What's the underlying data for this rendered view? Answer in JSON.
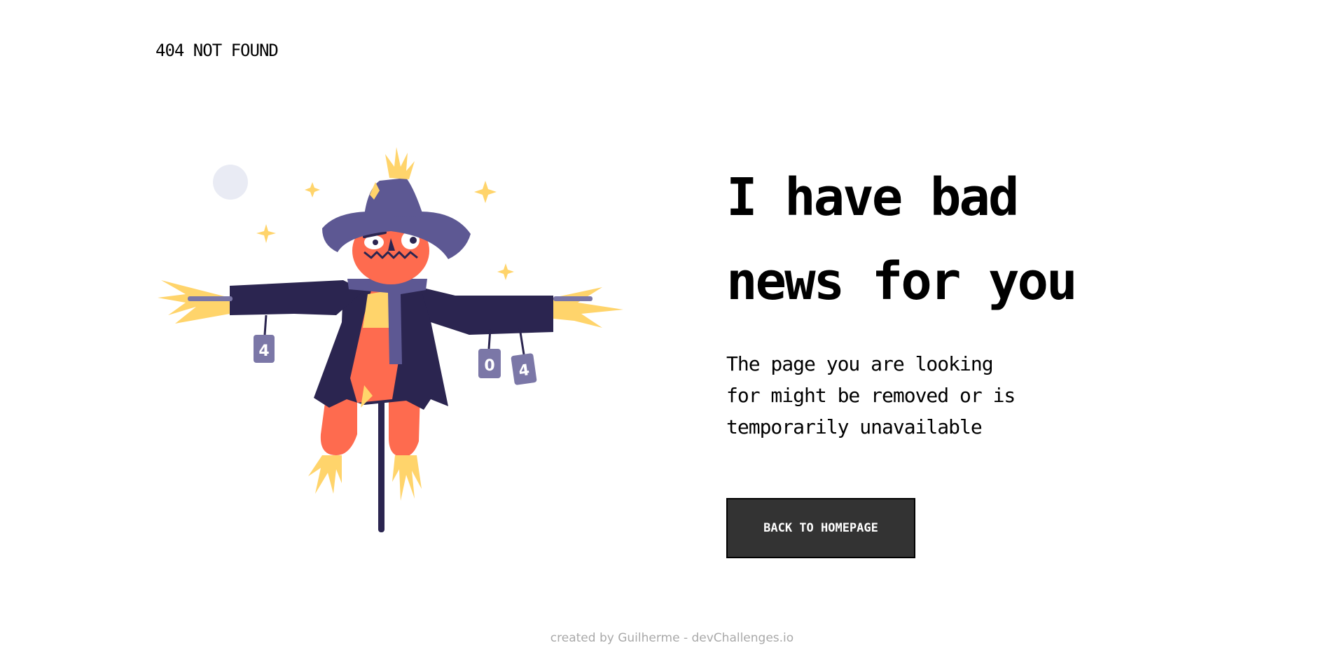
{
  "header": {
    "logo_text": "404 NOT FOUND"
  },
  "illustration": {
    "subject": "scarecrow-illustration",
    "can_labels": [
      "4",
      "0",
      "4"
    ]
  },
  "main": {
    "headline_line1": "I have bad",
    "headline_line2": "news for you",
    "description_line1": "The page you are looking",
    "description_line2": "for might be removed or is",
    "description_line3": "temporarily unavailable",
    "button_label": "BACK TO HOMEPAGE"
  },
  "footer": {
    "credit_text": "created by Guilherme - devChallenges.io"
  },
  "colors": {
    "background": "#ffffff",
    "text": "#000000",
    "button_background": "#333333",
    "button_text": "#ffffff",
    "footer_text": "#a9a9a9",
    "coat": "#2b2550",
    "hat": "#5d5893",
    "head": "#fe6b4f",
    "straw": "#ffd46b",
    "can": "#7b77a7",
    "moon": "#e9ebf4"
  }
}
